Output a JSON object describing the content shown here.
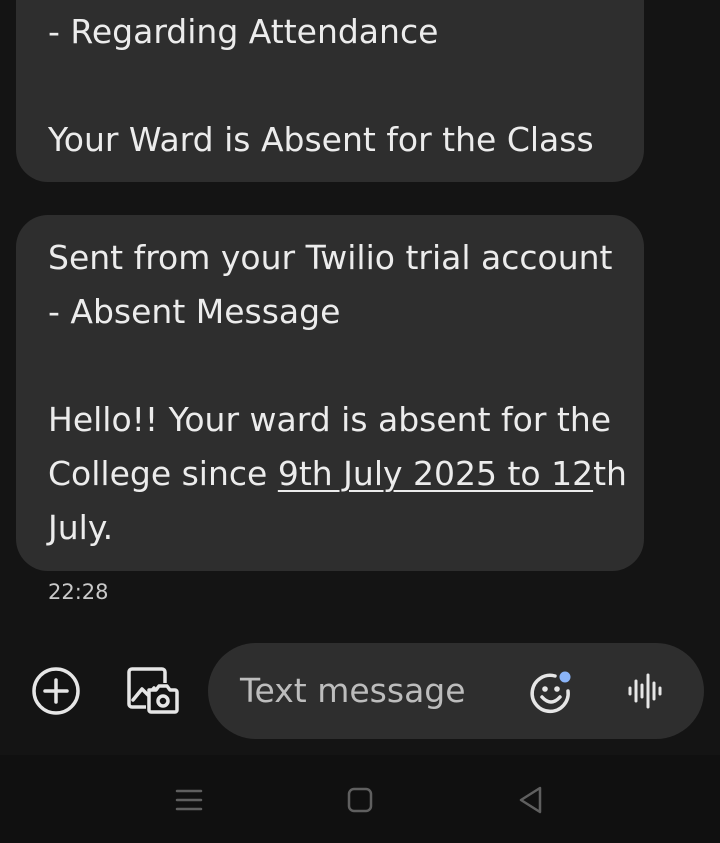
{
  "messages": [
    {
      "lines": [
        "- Regarding Attendance",
        "",
        "Your Ward is Absent for the Class"
      ]
    },
    {
      "line1": "Sent from your Twilio trial account",
      "line2": "- Absent Message",
      "line4": "Hello!!  Your ward is absent for the",
      "line5_prefix": "College since ",
      "line5_link": "9th July 2025 to 12",
      "line5_suffix": "th",
      "line6": "July.",
      "timestamp": "22:28"
    }
  ],
  "composer": {
    "placeholder": "Text message",
    "add_icon": "plus-circle-icon",
    "gallery_icon": "gallery-camera-icon",
    "emoji_icon": "emoji-icon",
    "voice_icon": "voice-waveform-icon"
  },
  "navbar": {
    "recents_icon": "recents-icon",
    "home_icon": "home-icon",
    "back_icon": "back-icon"
  },
  "colors": {
    "background": "#141414",
    "bubble": "#2e2e2e",
    "text": "#ececec",
    "emoji_dot": "#8ab4f8"
  }
}
